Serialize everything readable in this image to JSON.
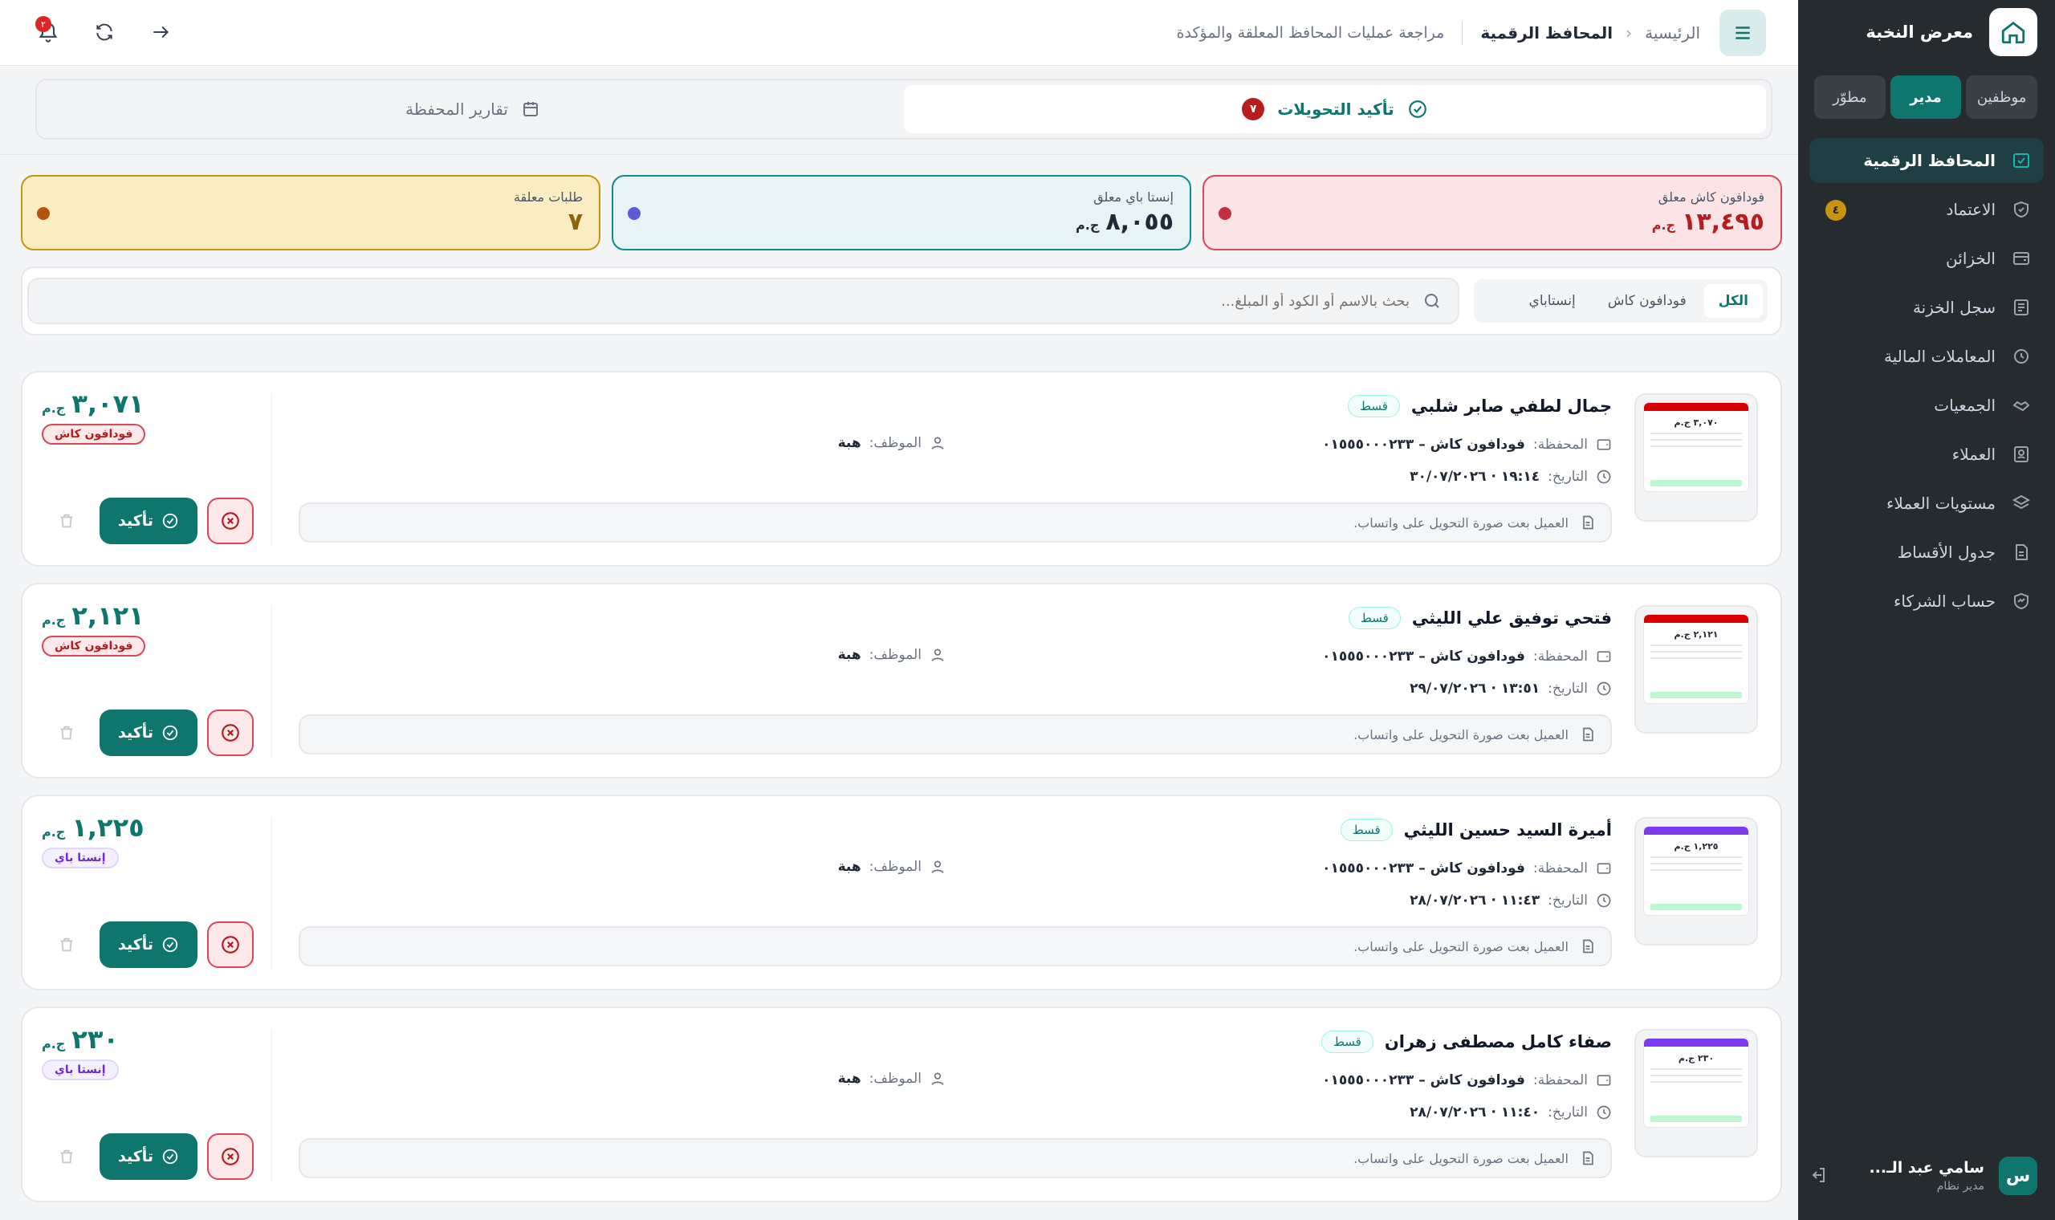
{
  "brand": {
    "name": "معرض النخبة"
  },
  "roles": [
    {
      "label": "موظفين",
      "active": false
    },
    {
      "label": "مدير",
      "active": true
    },
    {
      "label": "مطوّر",
      "active": false
    }
  ],
  "nav": {
    "items": [
      {
        "label": "المحافظ الرقمية",
        "icon": "wallet-check-icon"
      },
      {
        "label": "الاعتماد",
        "icon": "shield-check-icon",
        "badge": "٤"
      },
      {
        "label": "الخزائن",
        "icon": "safe-icon"
      },
      {
        "label": "سجل الخزنة",
        "icon": "ledger-icon"
      },
      {
        "label": "المعاملات المالية",
        "icon": "history-icon"
      },
      {
        "label": "الجمعيات",
        "icon": "handshake-icon"
      },
      {
        "label": "العملاء",
        "icon": "contacts-icon"
      },
      {
        "label": "مستويات العملاء",
        "icon": "layers-icon"
      },
      {
        "label": "جدول الأقساط",
        "icon": "document-icon"
      },
      {
        "label": "حساب الشركاء",
        "icon": "partners-icon"
      }
    ]
  },
  "user": {
    "initial": "س",
    "name": "سامي عبد الـ...",
    "role": "مدير نظام"
  },
  "topbar": {
    "home": "الرئيسية",
    "separator": "‹",
    "current": "المحافظ الرقمية",
    "description": "مراجعة عمليات المحافظ المعلقة والمؤكدة",
    "bell_count": "٢"
  },
  "tabs": [
    {
      "label": "تأكيد التحويلات",
      "count": "٧",
      "active": true
    },
    {
      "label": "تقارير المحفظة",
      "active": false
    }
  ],
  "stats": [
    {
      "label": "فودافون كاش معلق",
      "value": "١٣,٤٩٥",
      "unit": "ج.م",
      "tone": "red",
      "dot": "#c2303f"
    },
    {
      "label": "إنستا باي معلق",
      "value": "٨,٠٥٥",
      "unit": "ج.م",
      "tone": "blue",
      "dot": "#5b5bd6"
    },
    {
      "label": "طلبات معلقة",
      "value": "٧",
      "unit": "",
      "tone": "yellow",
      "dot": "#b45309"
    }
  ],
  "filters": {
    "tabs": [
      "الكل",
      "فودافون كاش",
      "إنستاباي"
    ],
    "search_placeholder": "بحث بالاسم أو الكود أو المبلغ..."
  },
  "labels": {
    "wallet": "المحفظة:",
    "date": "التاريخ:",
    "employee": "الموظف:",
    "confirm": "تأكيد"
  },
  "cards": [
    {
      "name": "جمال لطفي صابر شلبي",
      "badge": "قسط",
      "wallet": "فودافون كاش – ٠١٥٥٥٠٠٠٢٣٣",
      "date": "١٩:١٤ · ٣٠/٠٧/٢٠٢٦",
      "employee": "هبة",
      "note": "العميل بعت صورة التحويل على واتساب.",
      "amount": "٣,٠٧١",
      "unit": "ج.م",
      "wallet_tag": "فودافون كاش",
      "wallet_type": "voda",
      "receipt_amount": "٣,٠٧٠ ج.م",
      "receipt_color": "#d90000"
    },
    {
      "name": "فتحي توفيق علي الليثي",
      "badge": "قسط",
      "wallet": "فودافون كاش – ٠١٥٥٥٠٠٠٢٣٣",
      "date": "١٣:٥١ · ٢٩/٠٧/٢٠٢٦",
      "employee": "هبة",
      "note": "العميل بعت صورة التحويل على واتساب.",
      "amount": "٢,١٢١",
      "unit": "ج.م",
      "wallet_tag": "فودافون كاش",
      "wallet_type": "voda",
      "receipt_amount": "٢,١٢١ ج.م",
      "receipt_color": "#d90000"
    },
    {
      "name": "أميرة السيد حسين الليثي",
      "badge": "قسط",
      "wallet": "فودافون كاش – ٠١٥٥٥٠٠٠٢٣٣",
      "date": "١١:٤٣ · ٢٨/٠٧/٢٠٢٦",
      "employee": "هبة",
      "note": "العميل بعت صورة التحويل على واتساب.",
      "amount": "١,٢٢٥",
      "unit": "ج.م",
      "wallet_tag": "إنستا باي",
      "wallet_type": "insta",
      "receipt_amount": "١,٢٢٥ ج.م",
      "receipt_color": "#7c3aed"
    },
    {
      "name": "صفاء كامل مصطفى زهران",
      "badge": "قسط",
      "wallet": "فودافون كاش – ٠١٥٥٥٠٠٠٢٣٣",
      "date": "١١:٤٠ · ٢٨/٠٧/٢٠٢٦",
      "employee": "هبة",
      "note": "العميل بعت صورة التحويل على واتساب.",
      "amount": "٢٣٠",
      "unit": "ج.م",
      "wallet_tag": "إنستا باي",
      "wallet_type": "insta",
      "receipt_amount": "٢٣٠ ج.م",
      "receipt_color": "#7c3aed"
    }
  ]
}
